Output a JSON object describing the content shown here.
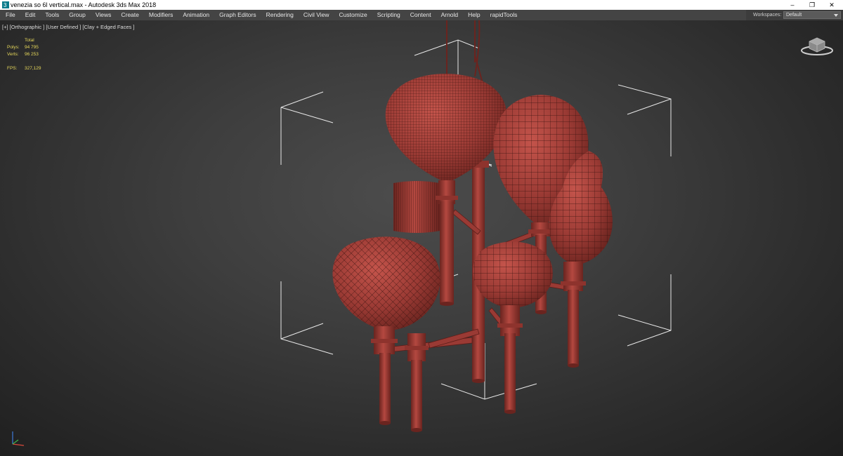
{
  "window": {
    "title": "venezia so 6l vertical.max - Autodesk 3ds Max 2018",
    "minimize": "–",
    "maximize": "❐",
    "close": "✕"
  },
  "menu": [
    "File",
    "Edit",
    "Tools",
    "Group",
    "Views",
    "Create",
    "Modifiers",
    "Animation",
    "Graph Editors",
    "Rendering",
    "Civil View",
    "Customize",
    "Scripting",
    "Content",
    "Arnold",
    "Help",
    "rapidTools"
  ],
  "workspaces": {
    "label": "Workspaces:",
    "value": "Default"
  },
  "viewport": {
    "label": "[+] [Orthographic ] [User Defined ] [Clay + Edged Faces ]",
    "stats": {
      "header": "Total",
      "polys_label": "Polys:",
      "polys": "94 795",
      "verts_label": "Verts:",
      "verts": "96 253",
      "fps_label": "FPS:",
      "fps": "327,129"
    }
  },
  "colors": {
    "clay": "#9a3a34",
    "wire": "#3a1310",
    "stats": "#e6d75a",
    "menubar": "#444444"
  },
  "icons": [
    "app-icon",
    "viewcube-icon",
    "axis-tripod-icon"
  ]
}
